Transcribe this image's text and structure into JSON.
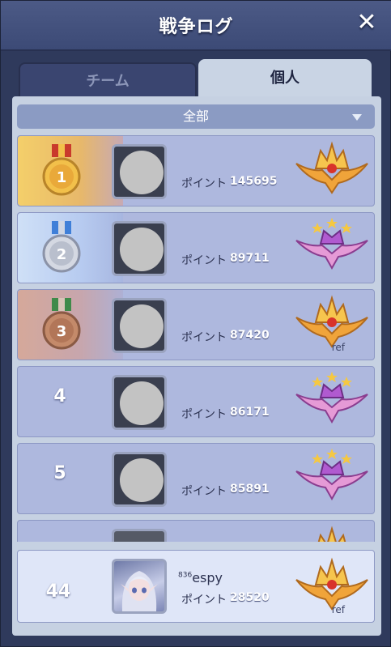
{
  "window": {
    "title": "戦争ログ",
    "close_label": "✕"
  },
  "tabs": [
    {
      "label": "チーム",
      "active": false
    },
    {
      "label": "個人",
      "active": true
    }
  ],
  "filter": {
    "selected": "全部"
  },
  "rows": [
    {
      "rank": "1",
      "points_label": "ポイント",
      "points": "145695",
      "emblem": "gold-crown-emblem-icon",
      "ref": ""
    },
    {
      "rank": "2",
      "points_label": "ポイント",
      "points": "89711",
      "emblem": "purple-winged-emblem-icon",
      "ref": ""
    },
    {
      "rank": "3",
      "points_label": "ポイント",
      "points": "87420",
      "emblem": "gold-crown-emblem-icon",
      "ref": "ref"
    },
    {
      "rank": "4",
      "points_label": "ポイント",
      "points": "86171",
      "emblem": "purple-winged-emblem-icon",
      "ref": ""
    },
    {
      "rank": "5",
      "points_label": "ポイント",
      "points": "85891",
      "emblem": "purple-winged-emblem-icon",
      "ref": ""
    },
    {
      "rank": "",
      "points_label": "",
      "points": "",
      "emblem": "gold-crown-emblem-icon",
      "ref": ""
    }
  ],
  "self": {
    "rank": "44",
    "level": "836",
    "name": "espy",
    "points_label": "ポイント",
    "points": "28520",
    "ref": "ref"
  },
  "colors": {
    "gold": "#f2c04a",
    "silver": "#c8ccd6",
    "bronze": "#c48a6a",
    "row_bg": "#aeb8de",
    "panel_bg": "#c6d1e2"
  }
}
